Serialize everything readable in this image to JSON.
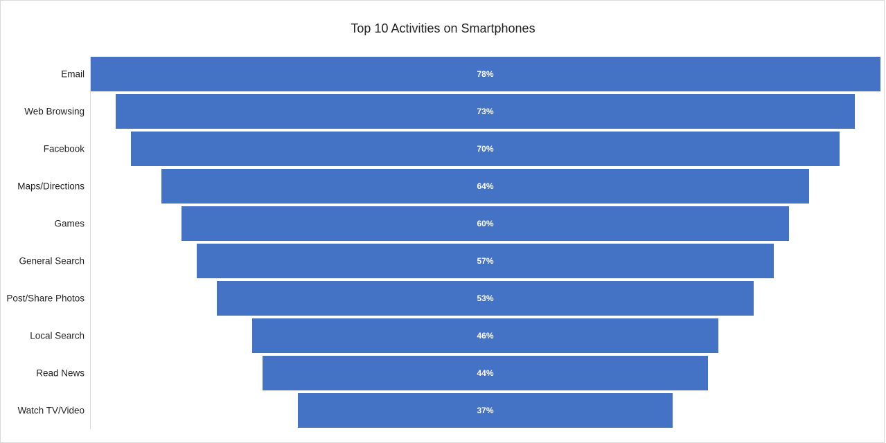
{
  "chart_data": {
    "type": "bar",
    "subtype": "funnel",
    "title": "Top 10 Activities on Smartphones",
    "xlabel": "",
    "ylabel": "",
    "categories": [
      "Email",
      "Web Browsing",
      "Facebook",
      "Maps/Directions",
      "Games",
      "General Search",
      "Post/Share Photos",
      "Local Search",
      "Read News",
      "Watch TV/Video"
    ],
    "values": [
      78,
      73,
      70,
      64,
      60,
      57,
      53,
      46,
      44,
      37
    ],
    "data_labels": [
      "78%",
      "73%",
      "70%",
      "64%",
      "60%",
      "57%",
      "53%",
      "46%",
      "44%",
      "37%"
    ],
    "value_unit": "%",
    "bar_color": "#4472c4",
    "label_color": "#ffffff",
    "grid": false,
    "legend": "none"
  }
}
